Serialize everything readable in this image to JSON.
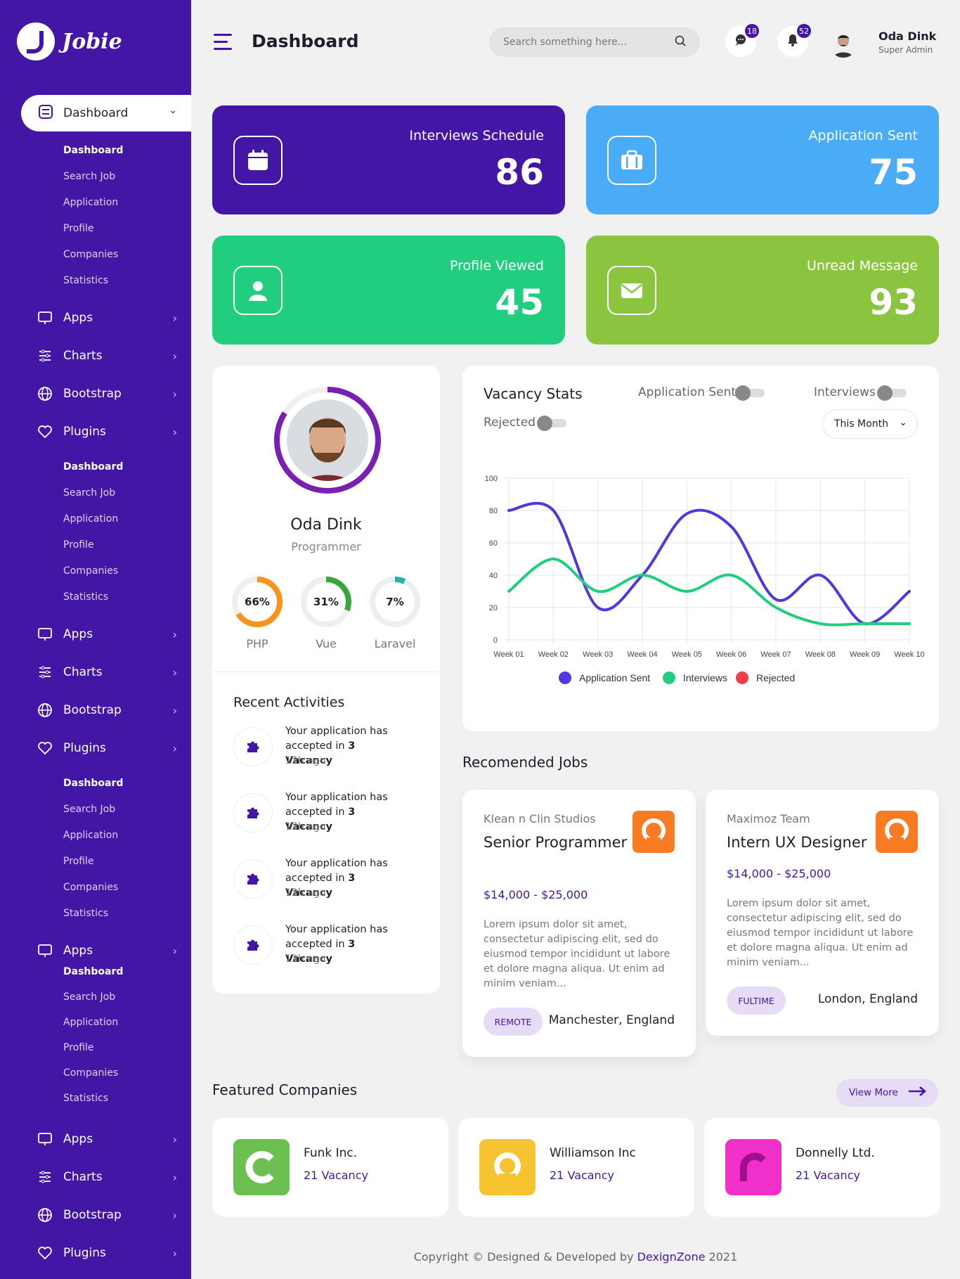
{
  "app": {
    "logo_text": "Jobie"
  },
  "sidebar": {
    "active": {
      "label": "Dashboard",
      "icon": "dashboard-icon"
    },
    "submenu": [
      "Dashboard",
      "Search Job",
      "Application",
      "Profile",
      "Companies",
      "Statistics"
    ],
    "items": [
      {
        "label": "Apps",
        "icon": "apps-icon"
      },
      {
        "label": "Charts",
        "icon": "charts-icon"
      },
      {
        "label": "Bootstrap",
        "icon": "bootstrap-icon"
      },
      {
        "label": "Plugins",
        "icon": "plugins-icon"
      }
    ]
  },
  "header": {
    "title": "Dashboard",
    "search_placeholder": "Search something here...",
    "messages_count": "18",
    "notifications_count": "52",
    "user_name": "Oda Dink",
    "user_role": "Super Admin"
  },
  "stats": [
    {
      "label": "Interviews Schedule",
      "value": "86",
      "color": "#4416a6",
      "icon": "calendar-icon"
    },
    {
      "label": "Application Sent",
      "value": "75",
      "color": "#4aabf7",
      "icon": "briefcase-icon"
    },
    {
      "label": "Profile Viewed",
      "value": "45",
      "color": "#21ce80",
      "icon": "user-icon"
    },
    {
      "label": "Unread Message",
      "value": "93",
      "color": "#8bc53f",
      "icon": "mail-icon"
    }
  ],
  "profile": {
    "name": "Oda Dink",
    "role": "Programmer",
    "skills": [
      {
        "label": "PHP",
        "percent": 66,
        "display": "66%",
        "color": "#f7941d"
      },
      {
        "label": "Vue",
        "percent": 31,
        "display": "31%",
        "color": "#3aa53a"
      },
      {
        "label": "Laravel",
        "percent": 7,
        "display": "7%",
        "color": "#27b59f"
      }
    ]
  },
  "activities": {
    "title": "Recent Activities",
    "items": [
      {
        "line1": "Your application has",
        "line2_pre": "accepted in ",
        "line2_bold": "3 Vacancy",
        "time": "12h ago"
      },
      {
        "line1": "Your application has",
        "line2_pre": "accepted in ",
        "line2_bold": "3 Vacancy",
        "time": "12h ago"
      },
      {
        "line1": "Your application has",
        "line2_pre": "accepted in ",
        "line2_bold": "3 Vacancy",
        "time": "12h ago"
      },
      {
        "line1": "Your application has",
        "line2_pre": "accepted in ",
        "line2_bold": "3 Vacancy",
        "time": "12h ago"
      }
    ]
  },
  "vacancy": {
    "title": "Vacancy Stats",
    "toggles": [
      "Application Sent",
      "Interviews",
      "Rejected"
    ],
    "period": "This Month"
  },
  "chart_data": {
    "type": "line",
    "x": [
      "Week 01",
      "Week 02",
      "Week 03",
      "Week 04",
      "Week 05",
      "Week 06",
      "Week 07",
      "Week 08",
      "Week 09",
      "Week 10"
    ],
    "ylim": [
      0,
      100
    ],
    "yticks": [
      0,
      20,
      40,
      60,
      80,
      100
    ],
    "grid": true,
    "legend": "bottom",
    "series": [
      {
        "name": "Application Sent",
        "color": "#5038e0",
        "values": [
          80,
          80,
          20,
          40,
          78,
          70,
          25,
          40,
          10,
          30
        ]
      },
      {
        "name": "Interviews",
        "color": "#21ce80",
        "values": [
          30,
          50,
          30,
          40,
          30,
          40,
          20,
          10,
          10,
          10
        ]
      },
      {
        "name": "Rejected",
        "color": "#f53c4b",
        "values": []
      }
    ]
  },
  "jobs": {
    "title": "Recomended Jobs",
    "items": [
      {
        "company": "Klean n Clin Studios",
        "title": "Senior Programmer",
        "salary": "$14,000 - $25,000",
        "desc": "Lorem ipsum dolor sit amet, consectetur adipiscing elit, sed do eiusmod tempor incididunt ut labore et dolore magna aliqua. Ut enim ad minim veniam...",
        "tag": "REMOTE",
        "location": "Manchester, England"
      },
      {
        "company": "Maximoz Team",
        "title": "Intern UX Designer",
        "salary": "$14,000 - $25,000",
        "desc": "Lorem ipsum dolor sit amet, consectetur adipiscing elit, sed do eiusmod tempor incididunt ut labore et dolore magna aliqua. Ut enim ad minim veniam...",
        "tag": "FULTIME",
        "location": "London, England"
      }
    ]
  },
  "companies": {
    "title": "Featured Companies",
    "view_more": "View More",
    "items": [
      {
        "name": "Funk Inc.",
        "vacancy": "21 Vacancy",
        "color": "#6cc051"
      },
      {
        "name": "Williamson Inc",
        "vacancy": "21 Vacancy",
        "color": "#f5c430"
      },
      {
        "name": "Donnelly Ltd.",
        "vacancy": "21 Vacancy",
        "color": "#f030c8"
      }
    ]
  },
  "footer": {
    "text": "Copyright © Designed & Developed by ",
    "brand": "DexignZone",
    "year": " 2021"
  }
}
